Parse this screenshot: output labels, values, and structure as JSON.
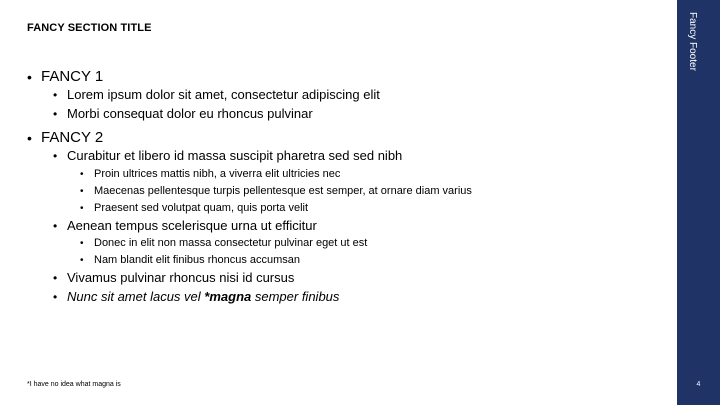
{
  "slide": {
    "section_title": "FANCY SECTION TITLE",
    "bullet_glyph": "•",
    "items": [
      {
        "label": "FANCY 1",
        "children": [
          {
            "label": "Lorem ipsum dolor sit amet, consectetur adipiscing elit"
          },
          {
            "label": "Morbi consequat dolor eu rhoncus pulvinar"
          }
        ]
      },
      {
        "label": "FANCY 2",
        "children": [
          {
            "label": "Curabitur et libero id massa suscipit pharetra sed sed nibh",
            "children": [
              {
                "label": "Proin ultrices mattis nibh, a viverra elit ultricies nec"
              },
              {
                "label": "Maecenas pellentesque turpis pellentesque est semper, at ornare diam varius"
              },
              {
                "label": "Praesent sed volutpat quam, quis porta velit"
              }
            ]
          },
          {
            "label": "Aenean tempus scelerisque urna ut efficitur",
            "children": [
              {
                "label": "Donec in elit non massa consectetur pulvinar eget ut est"
              },
              {
                "label": "Nam blandit elit finibus rhoncus accumsan"
              }
            ]
          },
          {
            "label": "Vivamus pulvinar rhoncus nisi id cursus"
          },
          {
            "label_parts": [
              "Nunc sit amet lacus vel ",
              "*magna",
              " semper finibus"
            ]
          }
        ]
      }
    ],
    "footnote": "*I have no idea what magna is",
    "footer": "Fancy Footer",
    "page_number": "4"
  },
  "colors": {
    "sidebar": "#1f3366",
    "sidebar_text": "#ffffff",
    "text": "#000000",
    "background": "#ffffff"
  }
}
